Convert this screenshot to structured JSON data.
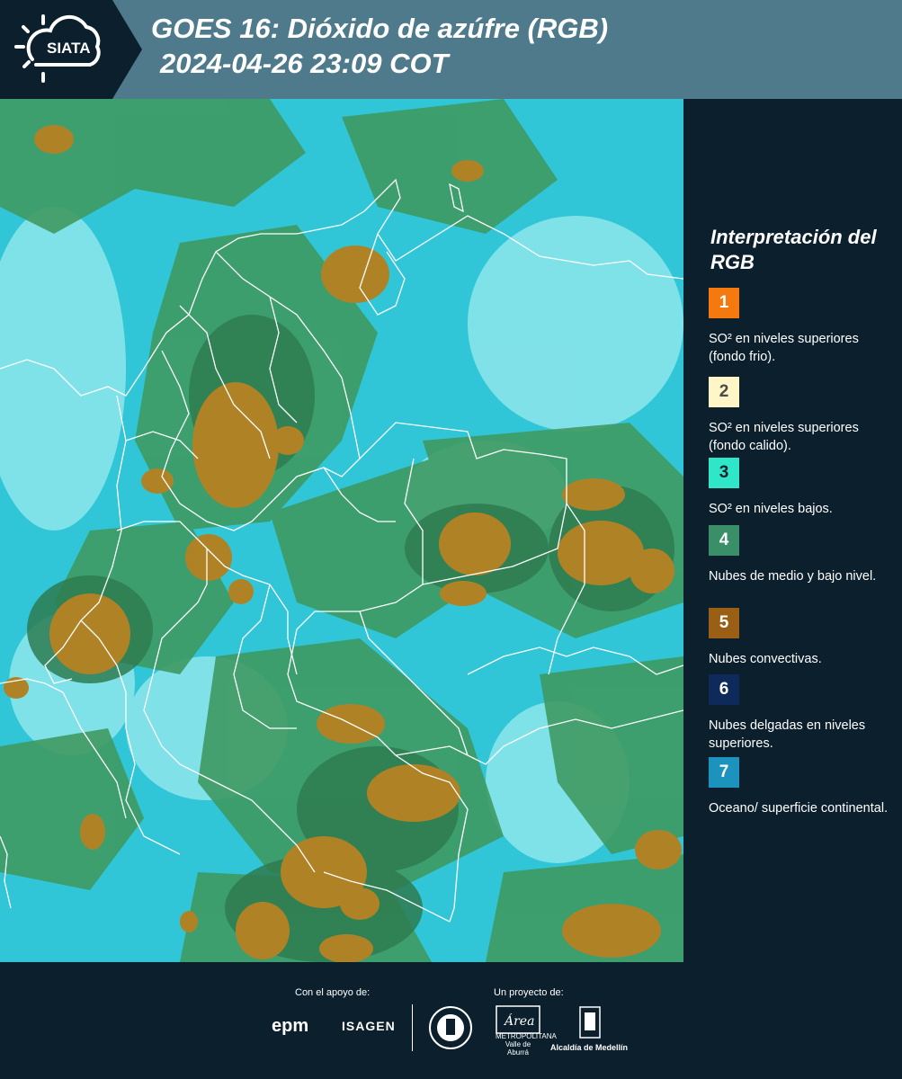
{
  "header": {
    "logo_text": "SIATA",
    "title": "GOES 16: Dióxido de azúfre (RGB)",
    "subtitle": "2024-04-26 23:09 COT"
  },
  "legend": {
    "title": "Interpretación del RGB",
    "items": [
      {
        "number": "1",
        "color": "#f47a0f",
        "text_color": "#ffffff",
        "label": "SO² en niveles superiores (fondo frio)."
      },
      {
        "number": "2",
        "color": "#fff6c8",
        "text_color": "#4a4a4a",
        "label": "SO² en niveles superiores (fondo calido)."
      },
      {
        "number": "3",
        "color": "#2fe6c8",
        "text_color": "#0b1f2c",
        "label": "SO² en niveles bajos."
      },
      {
        "number": "4",
        "color": "#3a8f68",
        "text_color": "#ffffff",
        "label": "Nubes de medio y bajo nivel."
      },
      {
        "number": "5",
        "color": "#9a5e14",
        "text_color": "#ffffff",
        "label": "Nubes convectivas."
      },
      {
        "number": "6",
        "color": "#0d2a5a",
        "text_color": "#ffffff",
        "label": "Nubes delgadas en niveles superiores."
      },
      {
        "number": "7",
        "color": "#1b93bd",
        "text_color": "#ffffff",
        "label": "Oceano/ superficie continental."
      }
    ]
  },
  "footer": {
    "support_label": "Con el apoyo de:",
    "project_label": "Un proyecto de:",
    "logos": {
      "epm": "epm",
      "isagen": "ISAGEN",
      "area": "METROPOLITANA Valle de Aburrá",
      "area_script": "Área",
      "alcaldia": "Alcaldía de Medellín"
    }
  },
  "map": {
    "colors": {
      "background_cyan": "#30c6d8",
      "pale_cyan": "#8ee6ec",
      "green": "#3f9a62",
      "dark_green": "#2e7b50",
      "convective_brown": "#b08226",
      "borders": "#ffffff"
    }
  }
}
